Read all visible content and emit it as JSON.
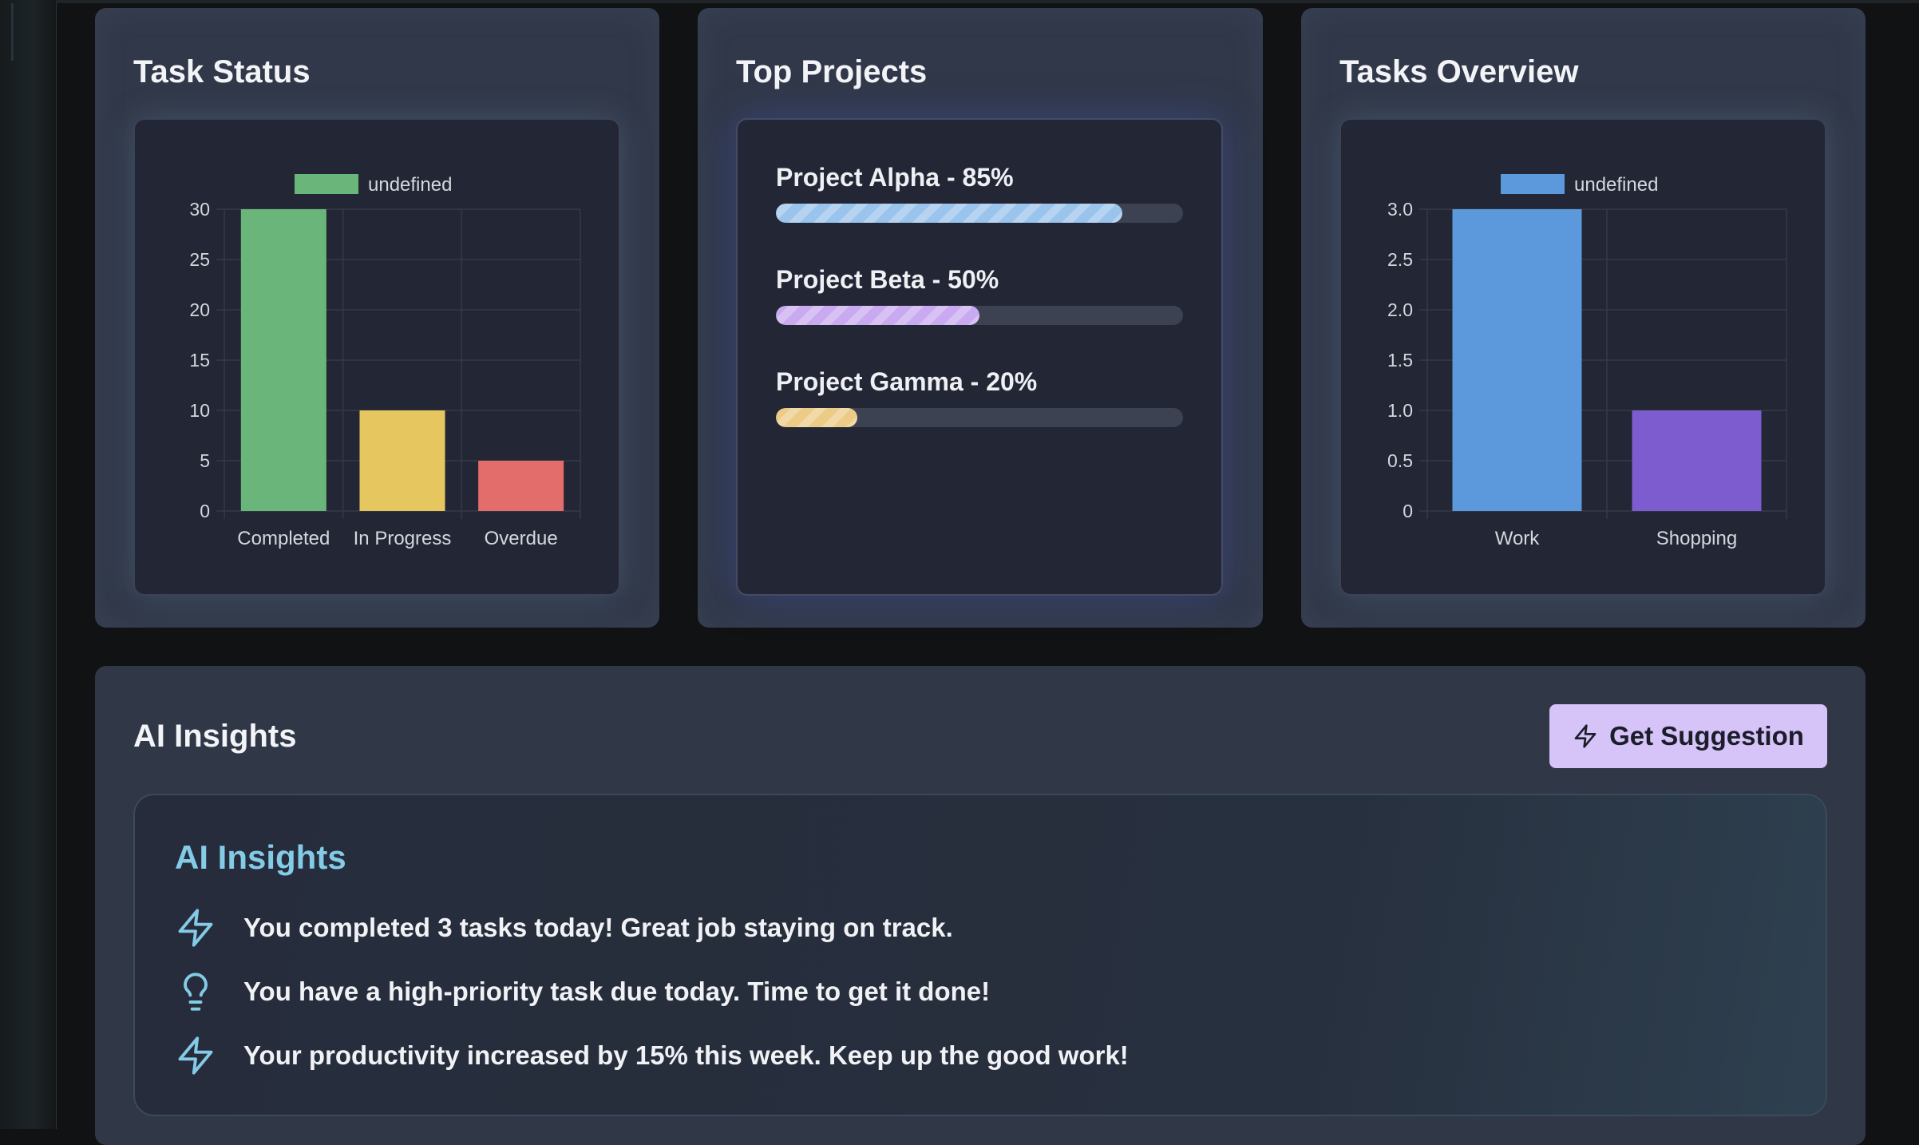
{
  "task_status": {
    "title": "Task Status",
    "chart_data": {
      "type": "bar",
      "categories": [
        "Completed",
        "In Progress",
        "Overdue"
      ],
      "values": [
        30,
        10,
        5
      ],
      "colors": [
        "#6ab67a",
        "#e6c75f",
        "#e26d6a"
      ],
      "legend": "undefined",
      "legend_color": "#6ab67a",
      "legend_position": "top",
      "ylim": [
        0,
        30
      ],
      "yticks": [
        "0",
        "5",
        "10",
        "15",
        "20",
        "25",
        "30"
      ],
      "grid": true
    }
  },
  "top_projects": {
    "title": "Top Projects",
    "projects": [
      {
        "label": "Project Alpha - 85%",
        "progress": 0.85,
        "color": "#9ac4ec"
      },
      {
        "label": "Project Beta - 50%",
        "progress": 0.5,
        "color": "#c9aaf0"
      },
      {
        "label": "Project Gamma - 20%",
        "progress": 0.2,
        "color": "#eccb86"
      }
    ]
  },
  "tasks_overview": {
    "title": "Tasks Overview",
    "chart_data": {
      "type": "bar",
      "categories": [
        "Work",
        "Shopping"
      ],
      "values": [
        3,
        1
      ],
      "colors": [
        "#5b99dc",
        "#7d5ccf"
      ],
      "legend": "undefined",
      "legend_color": "#5b99dc",
      "legend_position": "top",
      "ylim": [
        0,
        3
      ],
      "yticks": [
        "0",
        "0.5",
        "1.0",
        "1.5",
        "2.0",
        "2.5",
        "3.0"
      ],
      "grid": true
    }
  },
  "ai_insights": {
    "title": "AI Insights",
    "button_label": "Get Suggestion",
    "button_icon": "zap-icon",
    "panel_title": "AI Insights",
    "items": [
      {
        "icon": "zap-icon",
        "text": "You completed 3 tasks today! Great job staying on track."
      },
      {
        "icon": "lightbulb-icon",
        "text": "You have a high-priority task due today. Time to get it done!"
      },
      {
        "icon": "zap-icon",
        "text": "Your productivity increased by 15% this week. Keep up the good work!"
      }
    ]
  },
  "colors": {
    "accent": "#83cbe6",
    "button_bg": "#d6c3f7",
    "card_bg": "#313849",
    "panel_bg": "#232634"
  }
}
